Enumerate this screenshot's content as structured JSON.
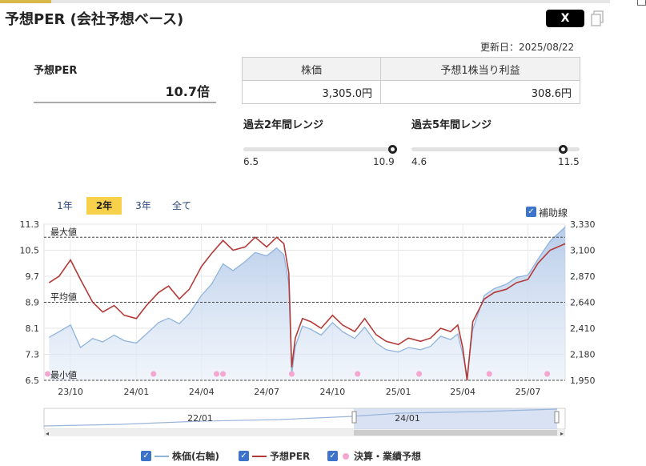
{
  "header": {
    "title": "予想PER (会社予想ベース)",
    "share_x_label": "X"
  },
  "updated": "更新日：2025/08/22",
  "per": {
    "label": "予想PER",
    "value": "10.7倍"
  },
  "table": {
    "headers": [
      "株価",
      "予想1株当り利益"
    ],
    "values": [
      "3,305.0円",
      "308.6円"
    ]
  },
  "ranges": [
    {
      "label": "過去2年間レンジ",
      "min": "6.5",
      "max": "10.9",
      "position": 0.98
    },
    {
      "label": "過去5年間レンジ",
      "min": "4.6",
      "max": "11.5",
      "position": 0.9
    }
  ],
  "periods": [
    "1年",
    "2年",
    "3年",
    "全て"
  ],
  "active_period": "2年",
  "aux_line_label": "補助線",
  "navigator": {
    "labels": [
      "22/01",
      "24/01"
    ]
  },
  "legend": {
    "price": "株価(右軸)",
    "per": "予想PER",
    "earnings": "決算・業績予想"
  },
  "colors": {
    "price_line": "#8fb4dc",
    "price_fill": "#c9d9ee",
    "per_line": "#b23a38",
    "earnings_dot": "#f4a6d0",
    "accent": "#f7d14a"
  },
  "chart_data": {
    "type": "line",
    "x_ticks": [
      "23/10",
      "24/01",
      "24/04",
      "24/07",
      "24/10",
      "25/01",
      "25/04",
      "25/07"
    ],
    "left_axis": {
      "ticks": [
        "11.3",
        "10.5",
        "9.7",
        "8.9",
        "8.1",
        "7.3",
        "6.5"
      ],
      "range": [
        6.5,
        11.3
      ]
    },
    "right_axis": {
      "ticks": [
        "3,330",
        "3,100",
        "2,870",
        "2,640",
        "2,410",
        "2,180",
        "1,950"
      ],
      "range": [
        1950,
        3330
      ]
    },
    "reference_lines": [
      {
        "label": "最大値",
        "value": 10.9
      },
      {
        "label": "平均値",
        "value": 8.9
      },
      {
        "label": "最小値",
        "value": 6.5
      }
    ],
    "series": [
      {
        "name": "予想PER",
        "axis": "left",
        "points": [
          [
            "2023-09-01",
            9.5
          ],
          [
            "2023-09-15",
            9.7
          ],
          [
            "2023-10-01",
            10.2
          ],
          [
            "2023-10-15",
            9.6
          ],
          [
            "2023-11-01",
            8.9
          ],
          [
            "2023-11-15",
            8.6
          ],
          [
            "2023-12-01",
            8.8
          ],
          [
            "2023-12-15",
            8.5
          ],
          [
            "2024-01-01",
            8.4
          ],
          [
            "2024-01-15",
            8.8
          ],
          [
            "2024-02-01",
            9.2
          ],
          [
            "2024-02-15",
            9.4
          ],
          [
            "2024-03-01",
            9.0
          ],
          [
            "2024-03-15",
            9.3
          ],
          [
            "2024-04-01",
            10.0
          ],
          [
            "2024-04-15",
            10.4
          ],
          [
            "2024-05-01",
            10.8
          ],
          [
            "2024-05-15",
            10.5
          ],
          [
            "2024-06-01",
            10.6
          ],
          [
            "2024-06-15",
            10.9
          ],
          [
            "2024-07-01",
            10.6
          ],
          [
            "2024-07-15",
            10.9
          ],
          [
            "2024-07-25",
            10.7
          ],
          [
            "2024-08-01",
            9.8
          ],
          [
            "2024-08-05",
            6.9
          ],
          [
            "2024-08-10",
            7.8
          ],
          [
            "2024-08-20",
            8.4
          ],
          [
            "2024-09-01",
            8.3
          ],
          [
            "2024-09-15",
            8.1
          ],
          [
            "2024-10-01",
            8.5
          ],
          [
            "2024-10-15",
            8.2
          ],
          [
            "2024-11-01",
            8.0
          ],
          [
            "2024-11-15",
            8.4
          ],
          [
            "2024-12-01",
            7.9
          ],
          [
            "2024-12-15",
            7.7
          ],
          [
            "2025-01-01",
            7.6
          ],
          [
            "2025-01-15",
            7.8
          ],
          [
            "2025-02-01",
            7.7
          ],
          [
            "2025-02-15",
            7.8
          ],
          [
            "2025-03-01",
            8.1
          ],
          [
            "2025-03-15",
            8.0
          ],
          [
            "2025-03-25",
            8.2
          ],
          [
            "2025-04-01",
            7.5
          ],
          [
            "2025-04-07",
            6.5
          ],
          [
            "2025-04-15",
            8.3
          ],
          [
            "2025-05-01",
            9.0
          ],
          [
            "2025-05-15",
            9.2
          ],
          [
            "2025-06-01",
            9.3
          ],
          [
            "2025-06-15",
            9.5
          ],
          [
            "2025-07-01",
            9.6
          ],
          [
            "2025-07-15",
            10.1
          ],
          [
            "2025-08-01",
            10.5
          ],
          [
            "2025-08-22",
            10.7
          ]
        ]
      },
      {
        "name": "株価(右軸)",
        "axis": "right",
        "points": [
          [
            "2023-09-01",
            2330
          ],
          [
            "2023-09-15",
            2380
          ],
          [
            "2023-10-01",
            2440
          ],
          [
            "2023-10-15",
            2240
          ],
          [
            "2023-11-01",
            2320
          ],
          [
            "2023-11-15",
            2290
          ],
          [
            "2023-12-01",
            2350
          ],
          [
            "2023-12-15",
            2300
          ],
          [
            "2024-01-01",
            2280
          ],
          [
            "2024-01-15",
            2360
          ],
          [
            "2024-02-01",
            2460
          ],
          [
            "2024-02-15",
            2500
          ],
          [
            "2024-03-01",
            2450
          ],
          [
            "2024-03-15",
            2540
          ],
          [
            "2024-04-01",
            2700
          ],
          [
            "2024-04-15",
            2800
          ],
          [
            "2024-05-01",
            2980
          ],
          [
            "2024-05-15",
            2920
          ],
          [
            "2024-06-01",
            3000
          ],
          [
            "2024-06-15",
            3080
          ],
          [
            "2024-07-01",
            3050
          ],
          [
            "2024-07-15",
            3120
          ],
          [
            "2024-07-25",
            3060
          ],
          [
            "2024-08-01",
            2800
          ],
          [
            "2024-08-05",
            2000
          ],
          [
            "2024-08-10",
            2250
          ],
          [
            "2024-08-20",
            2430
          ],
          [
            "2024-09-01",
            2400
          ],
          [
            "2024-09-15",
            2350
          ],
          [
            "2024-10-01",
            2460
          ],
          [
            "2024-10-15",
            2380
          ],
          [
            "2024-11-01",
            2320
          ],
          [
            "2024-11-15",
            2420
          ],
          [
            "2024-12-01",
            2280
          ],
          [
            "2024-12-15",
            2220
          ],
          [
            "2025-01-01",
            2200
          ],
          [
            "2025-01-15",
            2240
          ],
          [
            "2025-02-01",
            2220
          ],
          [
            "2025-02-15",
            2250
          ],
          [
            "2025-03-01",
            2340
          ],
          [
            "2025-03-15",
            2310
          ],
          [
            "2025-03-25",
            2360
          ],
          [
            "2025-04-01",
            2180
          ],
          [
            "2025-04-07",
            1990
          ],
          [
            "2025-04-15",
            2400
          ],
          [
            "2025-05-01",
            2700
          ],
          [
            "2025-05-15",
            2760
          ],
          [
            "2025-06-01",
            2800
          ],
          [
            "2025-06-15",
            2860
          ],
          [
            "2025-07-01",
            2880
          ],
          [
            "2025-07-15",
            3020
          ],
          [
            "2025-08-01",
            3180
          ],
          [
            "2025-08-22",
            3305
          ]
        ]
      }
    ],
    "earnings_markers": [
      "2023-08-30",
      "2024-01-25",
      "2024-04-22",
      "2024-05-01",
      "2024-08-05",
      "2024-11-05",
      "2025-01-30",
      "2025-05-08",
      "2025-07-28"
    ]
  }
}
